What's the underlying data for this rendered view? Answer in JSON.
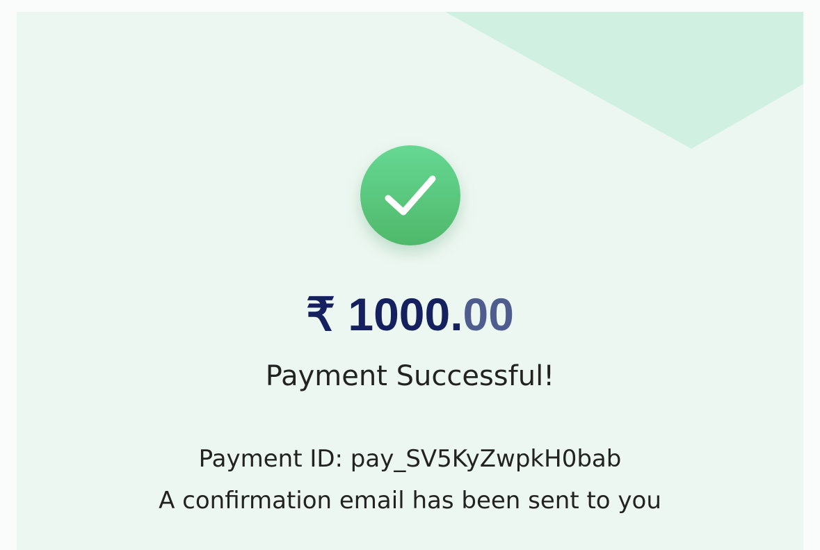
{
  "payment": {
    "currency_symbol": "₹",
    "amount_main": "1000.",
    "amount_paise": "00",
    "status": "Payment Successful!",
    "id_label": "Payment ID: pay_SV5KyZwpkH0bab",
    "confirmation": "A confirmation email has been sent to you"
  },
  "icons": {
    "success": "check-circle-icon"
  },
  "colors": {
    "card_background": "#edf7f1",
    "decor_shape": "#d0f1e1",
    "success_green": "#5cc57e",
    "amount_navy": "#14215e",
    "amount_paise": "#4e5c8e",
    "text": "#222222"
  }
}
